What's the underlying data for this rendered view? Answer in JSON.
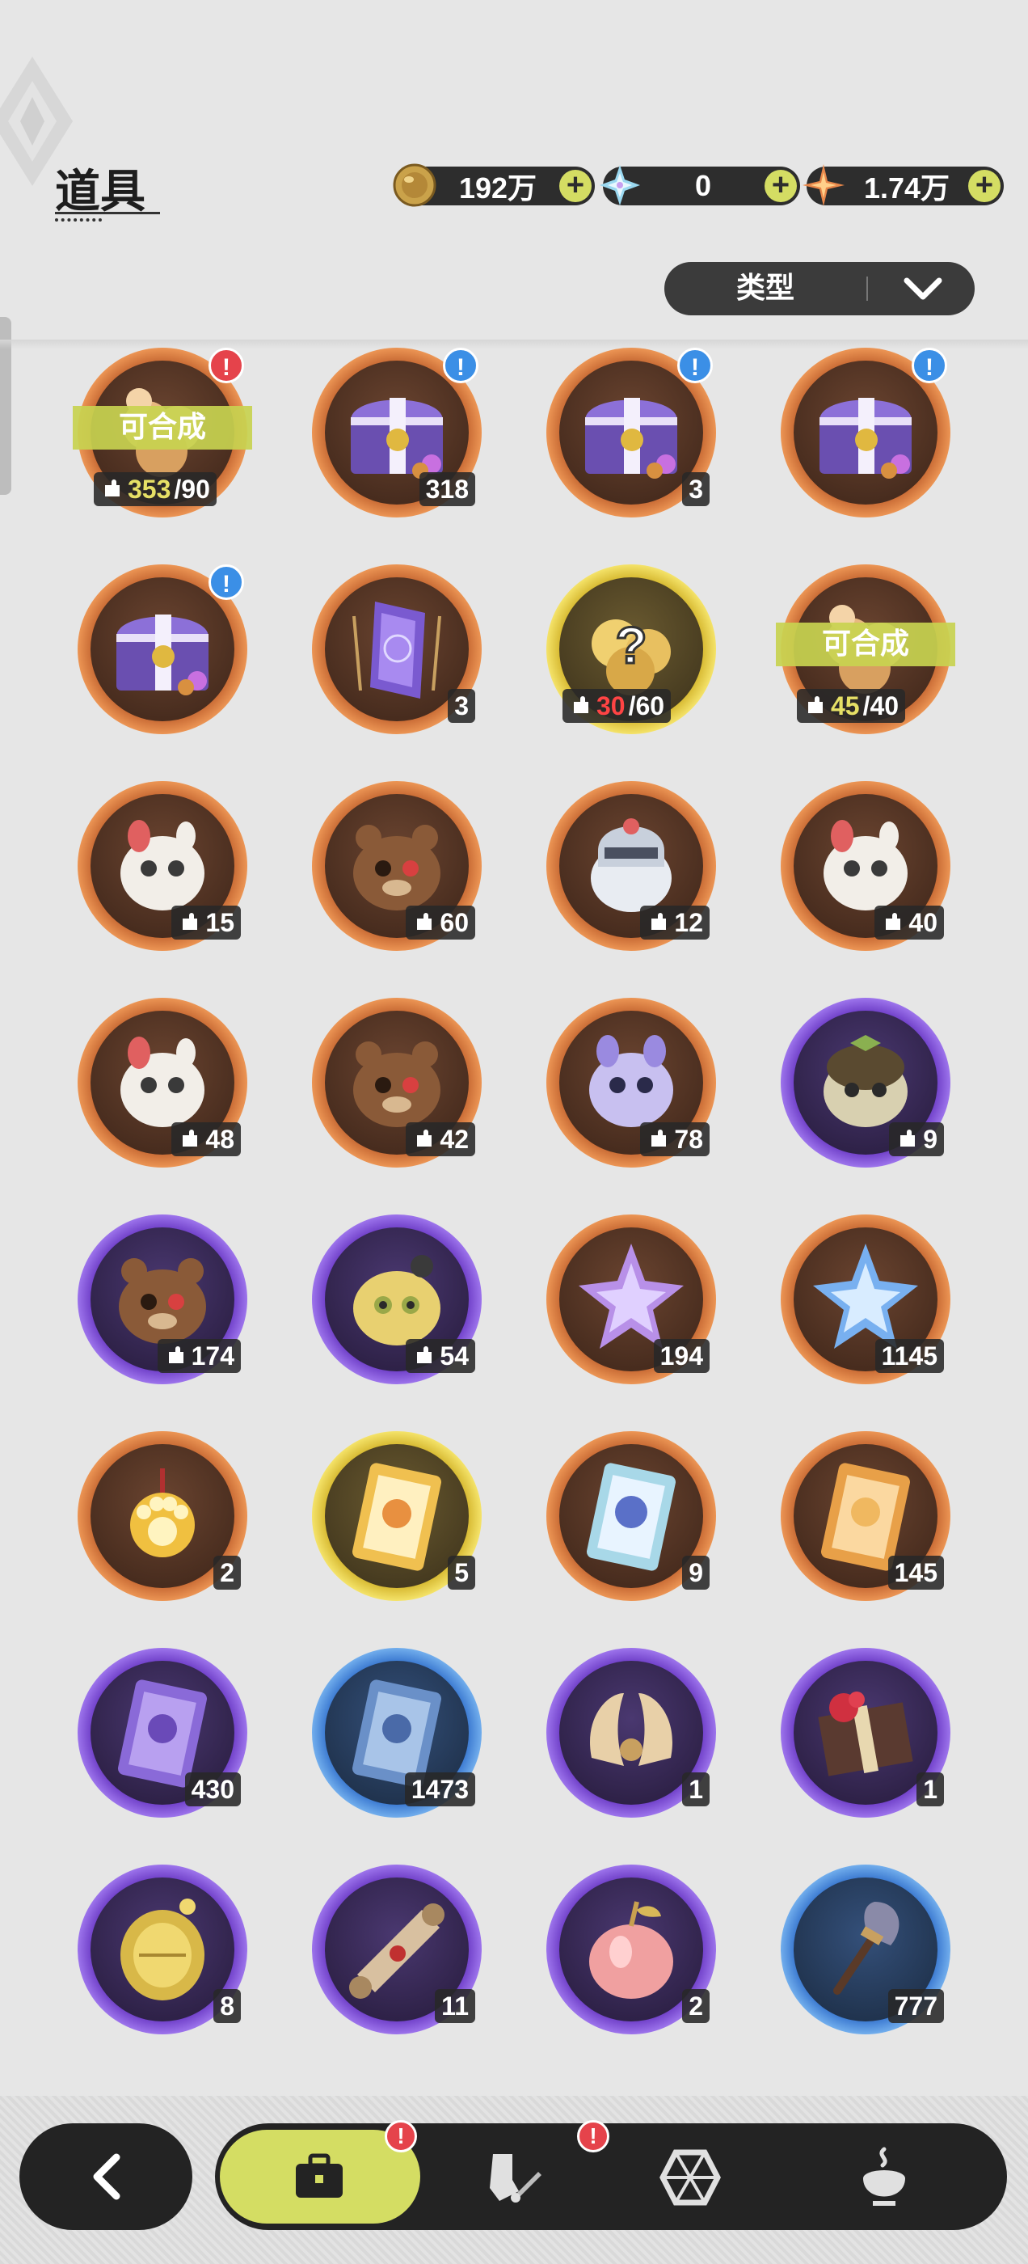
{
  "header": {
    "title": "道具",
    "currencies": [
      {
        "icon": "gold-coin-icon",
        "value": "192万"
      },
      {
        "icon": "crystal-icon",
        "value": "0"
      },
      {
        "icon": "star-shard-icon",
        "value": "1.74万"
      }
    ],
    "filter_label": "类型"
  },
  "items": [
    {
      "frame": "orange",
      "art": "fragment-bundle",
      "synth": "可合成",
      "frag_have": "353",
      "frag_need": "/90",
      "frag_state": "hi",
      "badge": "!",
      "badge_color": "red"
    },
    {
      "frame": "orange",
      "art": "chest",
      "count": "318",
      "badge": "!",
      "badge_color": "blue"
    },
    {
      "frame": "orange",
      "art": "chest",
      "count": "3",
      "badge": "!",
      "badge_color": "blue"
    },
    {
      "frame": "orange",
      "art": "chest",
      "count": "",
      "badge": "!",
      "badge_color": "blue"
    },
    {
      "frame": "orange",
      "art": "chest",
      "count": "",
      "badge": "!",
      "badge_color": "blue"
    },
    {
      "frame": "orange",
      "art": "crystal-gem",
      "count": "3"
    },
    {
      "frame": "gold",
      "art": "mystery",
      "frag_have": "30",
      "frag_need": "/60",
      "frag_state": "low"
    },
    {
      "frame": "orange",
      "art": "fragment-bundle",
      "synth": "可合成",
      "frag_have": "45",
      "frag_need": "/40",
      "frag_state": "hi"
    },
    {
      "frame": "orange",
      "art": "creature-white",
      "frag_total": "15"
    },
    {
      "frame": "orange",
      "art": "creature-brown",
      "frag_total": "60"
    },
    {
      "frame": "orange",
      "art": "creature-knight",
      "frag_total": "12"
    },
    {
      "frame": "orange",
      "art": "creature-white",
      "frag_total": "40"
    },
    {
      "frame": "orange",
      "art": "creature-white",
      "frag_total": "48"
    },
    {
      "frame": "orange",
      "art": "creature-brown",
      "frag_total": "42"
    },
    {
      "frame": "orange",
      "art": "creature-lilac",
      "frag_total": "78"
    },
    {
      "frame": "purple",
      "art": "creature-olive",
      "frag_total": "9"
    },
    {
      "frame": "purple",
      "art": "creature-brown",
      "frag_total": "174"
    },
    {
      "frame": "purple",
      "art": "creature-yellow",
      "frag_total": "54"
    },
    {
      "frame": "orange",
      "art": "star-purple",
      "count": "194"
    },
    {
      "frame": "orange",
      "art": "star-blue",
      "count": "1145"
    },
    {
      "frame": "orange",
      "art": "paw-charm",
      "count": "2"
    },
    {
      "frame": "gold",
      "art": "card-gold",
      "count": "5"
    },
    {
      "frame": "orange",
      "art": "card-rainbow",
      "count": "9"
    },
    {
      "frame": "orange",
      "art": "card-orange",
      "count": "145"
    },
    {
      "frame": "purple",
      "art": "card-purple",
      "count": "430"
    },
    {
      "frame": "blue",
      "art": "card-blue",
      "count": "1473"
    },
    {
      "frame": "purple",
      "art": "horn-ornament",
      "count": "1"
    },
    {
      "frame": "purple",
      "art": "gift-box",
      "count": "1"
    },
    {
      "frame": "purple",
      "art": "golden-egg",
      "count": "8"
    },
    {
      "frame": "purple",
      "art": "scroll",
      "count": "11"
    },
    {
      "frame": "purple",
      "art": "apple",
      "count": "2"
    },
    {
      "frame": "blue",
      "art": "shovel",
      "count": "777"
    }
  ],
  "nav": {
    "items": [
      {
        "name": "bag-icon",
        "badge": "!"
      },
      {
        "name": "gear-equipment-icon",
        "badge": "!"
      },
      {
        "name": "hexagon-icon"
      },
      {
        "name": "pot-icon"
      }
    ]
  },
  "colors": {
    "accent": "#d4dd63",
    "dark": "#232323",
    "badge_red": "#e5434b",
    "badge_blue": "#3b8fe6"
  }
}
